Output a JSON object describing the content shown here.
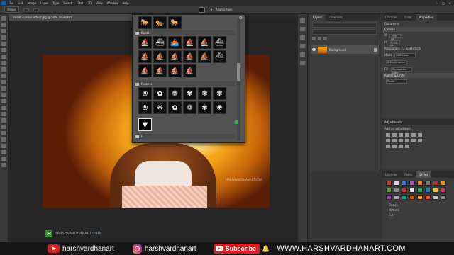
{
  "menubar": {
    "items": [
      "File",
      "Edit",
      "Image",
      "Layer",
      "Type",
      "Select",
      "Filter",
      "3D",
      "View",
      "Window",
      "Help"
    ]
  },
  "options": {
    "mode": "Shape",
    "align_edges": "Align Edges"
  },
  "document": {
    "tab_title": "sweet sunrise effect.jpg @ 50% (RGB/8#)"
  },
  "shape_picker": {
    "folders": [
      "Boats",
      "Flowers",
      "F",
      "L..."
    ],
    "boat_shapes": [
      "⛵",
      "⛴",
      "🚣",
      "⛵",
      "⛵",
      "⛴",
      "⛵",
      "⛵",
      "⛵",
      "⛵",
      "⛵",
      "⛴",
      "⛵",
      "⛵",
      "⛵",
      "⛵"
    ],
    "flower_shapes": [
      "❀",
      "✿",
      "❁",
      "✾",
      "❃",
      "✽",
      "❀",
      "❋",
      "✿",
      "❁",
      "✾",
      "❀"
    ],
    "animal_shapes": [
      "🐎",
      "🐅",
      "🐎"
    ],
    "selected_shape": "▼"
  },
  "layers_panel": {
    "tabs": [
      "Layers",
      "Channels"
    ],
    "layer_name": "Background"
  },
  "properties_panel": {
    "tabs": [
      "Libraries",
      "Color",
      "Properties"
    ],
    "section": "Document",
    "canvas_label": "Canvas",
    "width": "3000 px",
    "height": "2000 px",
    "resolution_label": "Resolution: 72 pixels/inch",
    "mode_label": "Mode",
    "mode_value": "RGB Color",
    "depth_value": "8 Bits/Channel",
    "fill_label": "Fill",
    "fill_value": "Transparent Color",
    "rulers_label": "Rulers & Grids",
    "rulers_unit": "Pixels"
  },
  "adjustments_panel": {
    "title": "Adjustments",
    "subtitle": "Add an adjustment"
  },
  "styles_panel": {
    "tabs": [
      "Libraries",
      "Paths",
      "Styles"
    ],
    "folders": [
      "Basics",
      "Natural",
      "Fur"
    ],
    "swatch_colors": [
      "#c8402e",
      "#d9d9d9",
      "#3a7bd5",
      "#9b59b6",
      "#e67e22",
      "#777777",
      "#b03030",
      "#d4a017",
      "#5a9e3a",
      "#888888",
      "#c0392b",
      "#e8e8e8",
      "#27ae60",
      "#2980b9",
      "#f1c40f",
      "#cc3366",
      "#8e44ad",
      "#aaaaaa",
      "#16a085",
      "#d35400",
      "#f39c12",
      "#e74c3c",
      "#bdc3c7",
      "#7f8c8d"
    ]
  },
  "watermarks": {
    "photo": "HARSHVARDHANART.COM",
    "canvas": "HARSHVARDHANART.COM",
    "logo_letter": "H"
  },
  "promo_bar": {
    "youtube_handle": "harshvardhanart",
    "instagram_handle": "harshvardhanart",
    "subscribe_label": "Subscribe",
    "bell": "🔔",
    "website": "WWW.HARSHVARDHANART.COM"
  }
}
